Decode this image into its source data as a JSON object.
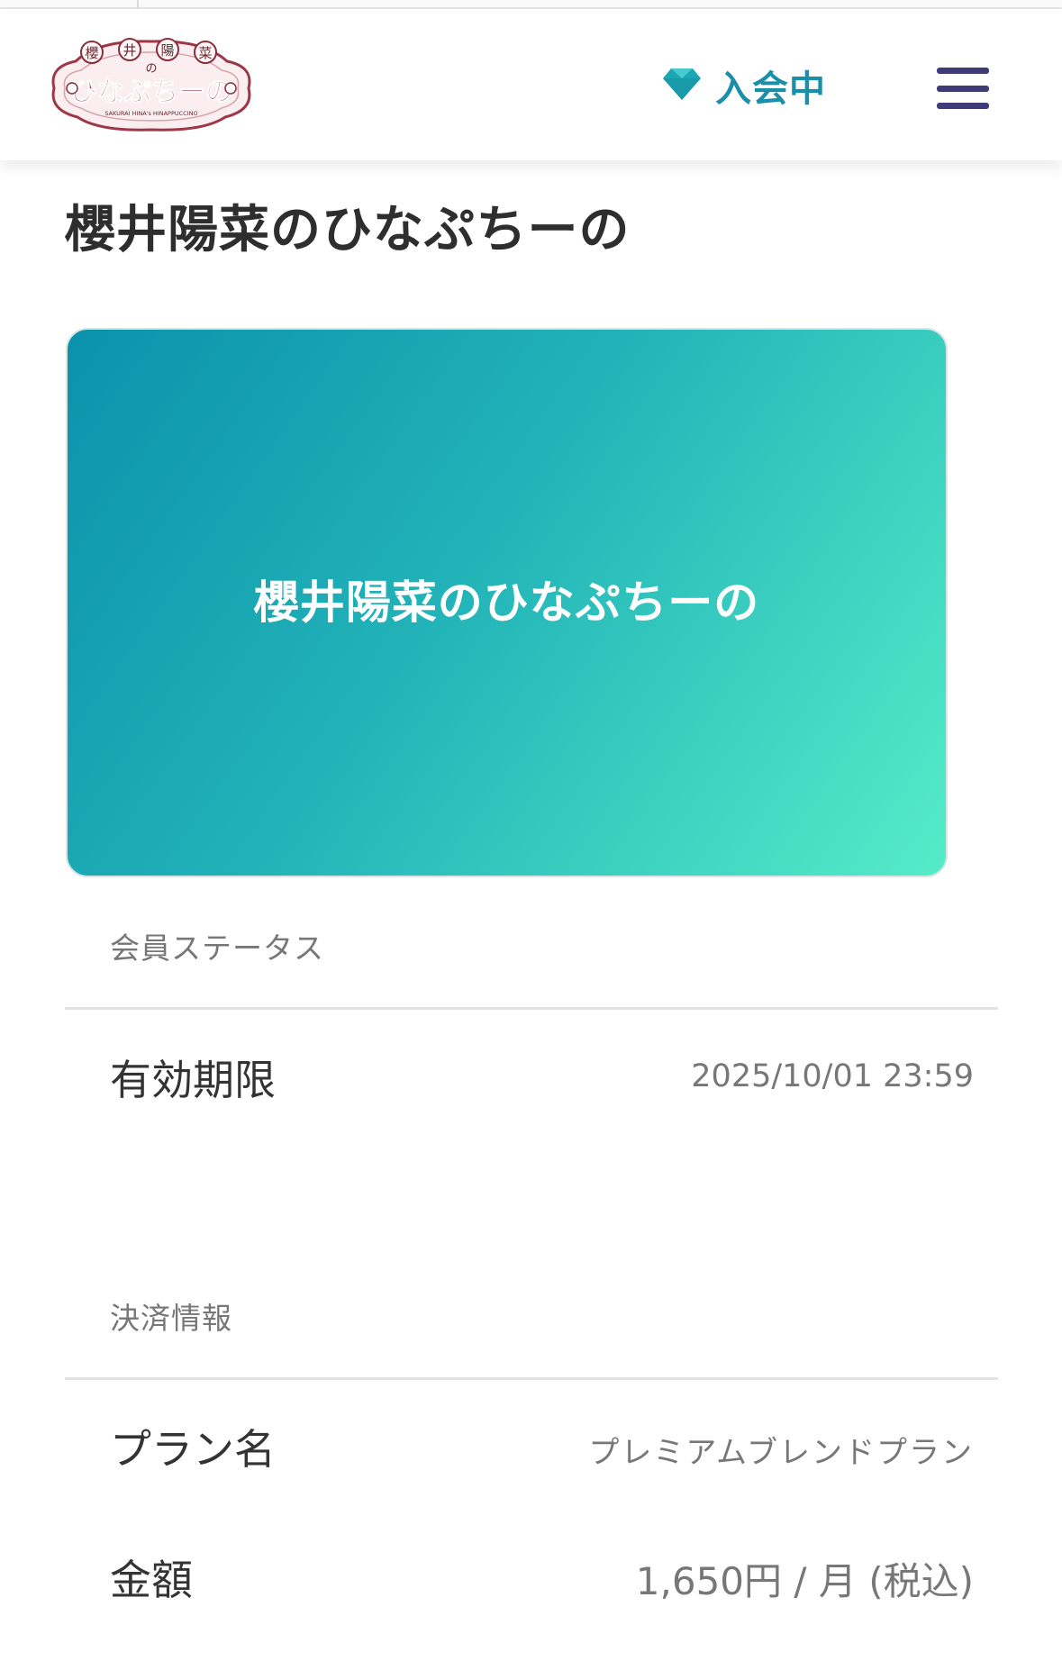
{
  "header": {
    "logo": {
      "title_chars": [
        "櫻",
        "井",
        "陽",
        "菜"
      ],
      "connector": "の",
      "main_text": "ひなぷちーの",
      "subtitle": "SAKURAI HINA's HINAPPUCCINO"
    },
    "membership_status": "入会中",
    "status_icon": "diamond-icon",
    "menu_icon": "hamburger-menu-icon",
    "accent_color": "#1b8fa8",
    "menu_color": "#3f3a78"
  },
  "page": {
    "title": "櫻井陽菜のひなぷちーの"
  },
  "card": {
    "title": "櫻井陽菜のひなぷちーの",
    "gradient_start": "#0b92ac",
    "gradient_end": "#55ecc8"
  },
  "member_status": {
    "section_label": "会員ステータス",
    "expiry_label": "有効期限",
    "expiry_value": "2025/10/01 23:59"
  },
  "payment": {
    "section_label": "決済情報",
    "plan_label": "プラン名",
    "plan_value": "プレミアムブレンドプラン",
    "amount_label": "金額",
    "amount_value": "1,650円 / 月 (税込)"
  }
}
